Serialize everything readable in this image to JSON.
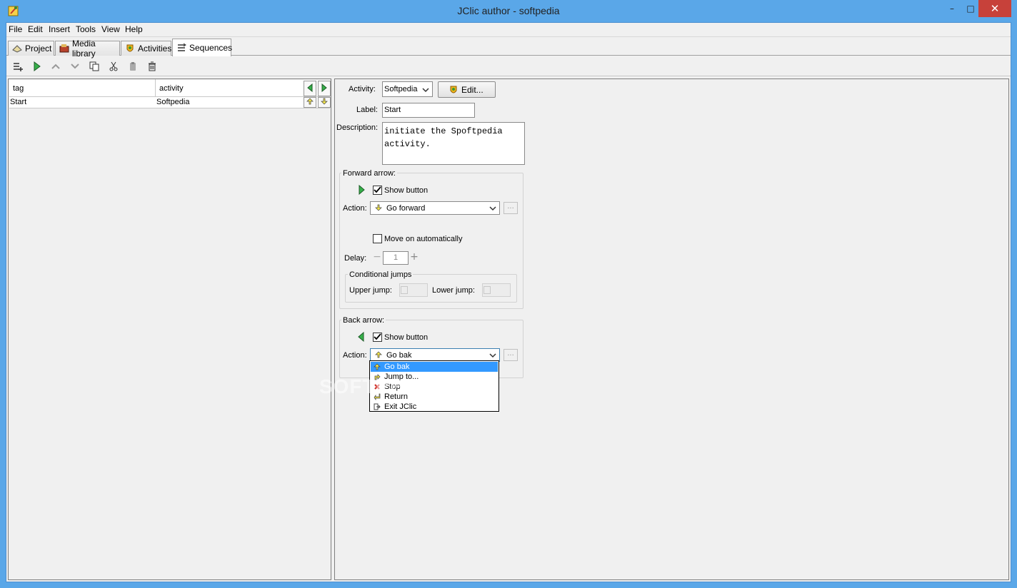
{
  "window": {
    "title": "JClic author - softpedia",
    "minimize": "–",
    "maximize": "□",
    "close": "✕"
  },
  "menu": [
    "File",
    "Edit",
    "Insert",
    "Tools",
    "View",
    "Help"
  ],
  "tabs": [
    {
      "label": "Project",
      "icon": "project-icon"
    },
    {
      "label": "Media library",
      "icon": "media-library-icon"
    },
    {
      "label": "Activities",
      "icon": "activities-icon"
    },
    {
      "label": "Sequences",
      "icon": "sequences-icon",
      "active": true
    }
  ],
  "toolbar": [
    "new-sequence-icon",
    "play-icon",
    "move-up-icon",
    "move-down-icon",
    "copy-icon",
    "cut-icon",
    "paste-icon",
    "delete-icon"
  ],
  "table": {
    "headers": [
      "tag",
      "activity"
    ],
    "rows": [
      {
        "tag": "Start",
        "activity": "Softpedia"
      }
    ]
  },
  "details": {
    "activity_label": "Activity:",
    "activity_value": "Softpedia",
    "edit_button": "Edit...",
    "label_label": "Label:",
    "label_value": "Start",
    "description_label": "Description:",
    "description_value": "initiate the Spoftpedia activity."
  },
  "forward": {
    "title": "Forward arrow:",
    "show_button": "Show button",
    "action_label": "Action:",
    "action_value": "Go forward",
    "move_on": "Move on automatically",
    "delay_label": "Delay:",
    "delay_value": "1",
    "conditional_title": "Conditional jumps",
    "upper_jump": "Upper jump:",
    "lower_jump": "Lower jump:",
    "dots": "..."
  },
  "back": {
    "title": "Back arrow:",
    "show_button": "Show button",
    "action_label": "Action:",
    "action_value": "Go bak",
    "dots": "..."
  },
  "dropdown": [
    "Go bak",
    "Jump to...",
    "Stop",
    "Return",
    "Exit JClic"
  ],
  "watermark": "SOFTPEDIA",
  "colors": {
    "titlebar": "#5aa7e8",
    "selection": "#3399ff",
    "close": "#c7413a"
  }
}
